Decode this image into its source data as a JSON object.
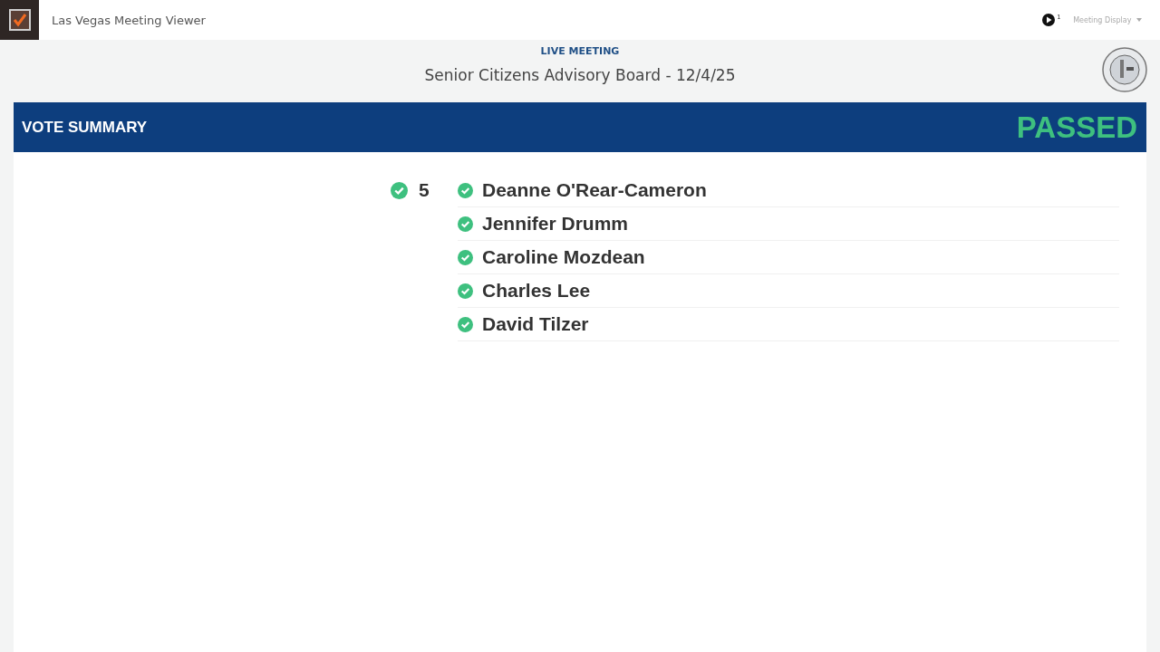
{
  "app": {
    "title": "Las Vegas Meeting Viewer"
  },
  "toolbar": {
    "play_count": "1",
    "display_menu": "Meeting Display"
  },
  "meeting": {
    "status": "LIVE MEETING",
    "title": "Senior Citizens Advisory Board - 12/4/25"
  },
  "vote_summary": {
    "heading": "VOTE SUMMARY",
    "result": "PASSED",
    "groups": [
      {
        "kind": "yes",
        "count": "5",
        "names": [
          "Deanne O'Rear-Cameron",
          "Jennifer Drumm",
          "Caroline Mozdean",
          "Charles Lee",
          "David Tilzer"
        ]
      }
    ]
  }
}
